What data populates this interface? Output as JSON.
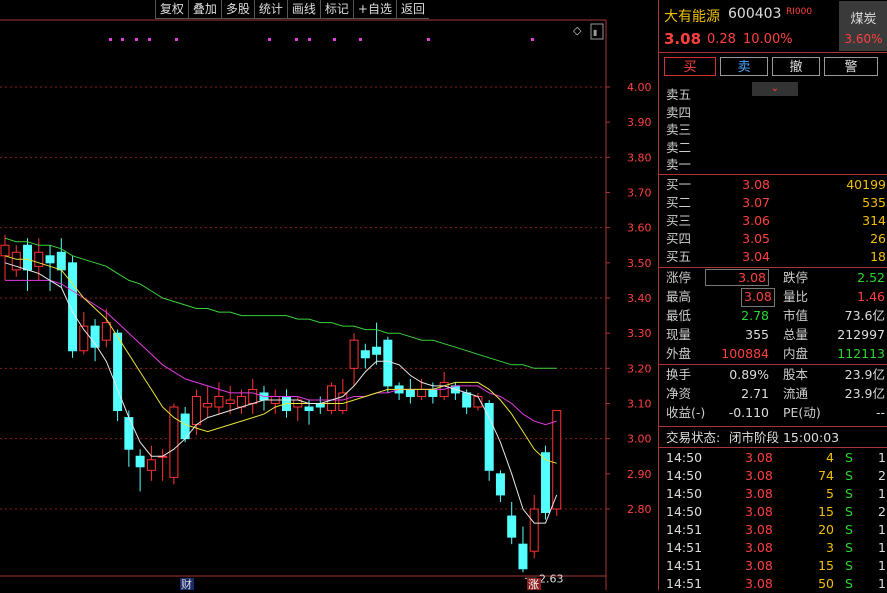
{
  "toolbar": [
    "复权",
    "叠加",
    "多股",
    "统计",
    "画线",
    "标记",
    "+自选",
    "返回"
  ],
  "stock": {
    "name": "大有能源",
    "code": "600403",
    "tag": "RI000",
    "price": "3.08",
    "change": "0.28",
    "pct": "10.00%",
    "sector": "煤炭",
    "sector_pct": "3.60%"
  },
  "trade_buttons": {
    "buy": "买",
    "sell": "卖",
    "cancel": "撤",
    "alert": "警"
  },
  "sell_levels": [
    "卖五",
    "卖四",
    "卖三",
    "卖二",
    "卖一"
  ],
  "buy_levels": [
    {
      "label": "买一",
      "price": "3.08",
      "vol": "40199"
    },
    {
      "label": "买二",
      "price": "3.07",
      "vol": "535"
    },
    {
      "label": "买三",
      "price": "3.06",
      "vol": "314"
    },
    {
      "label": "买四",
      "price": "3.05",
      "vol": "26"
    },
    {
      "label": "买五",
      "price": "3.04",
      "vol": "18"
    }
  ],
  "stats": {
    "limit_up_label": "涨停",
    "limit_up": "3.08",
    "limit_down_label": "跌停",
    "limit_down": "2.52",
    "high_label": "最高",
    "high": "3.08",
    "vol_ratio_label": "量比",
    "vol_ratio": "1.46",
    "low_label": "最低",
    "low": "2.78",
    "mktcap_label": "市值",
    "mktcap": "73.6亿",
    "cur_vol_label": "现量",
    "cur_vol": "355",
    "total_vol_label": "总量",
    "total_vol": "212997",
    "outer_label": "外盘",
    "outer": "100884",
    "inner_label": "内盘",
    "inner": "112113",
    "turnover_label": "换手",
    "turnover": "0.89%",
    "shares_label": "股本",
    "shares": "23.9亿",
    "netasset_label": "净资",
    "netasset": "2.71",
    "float_label": "流通",
    "float": "23.9亿",
    "eps_label": "收益(-)",
    "eps": "-0.110",
    "pe_label": "PE(动)",
    "pe": "--"
  },
  "trade_status": {
    "label": "交易状态:",
    "value": "闭市阶段 15:00:03"
  },
  "ticks": [
    {
      "time": "14:50",
      "price": "3.08",
      "vol": "4",
      "side": "S",
      "n": "1"
    },
    {
      "time": "14:50",
      "price": "3.08",
      "vol": "74",
      "side": "S",
      "n": "2"
    },
    {
      "time": "14:50",
      "price": "3.08",
      "vol": "5",
      "side": "S",
      "n": "1"
    },
    {
      "time": "14:50",
      "price": "3.08",
      "vol": "15",
      "side": "S",
      "n": "2"
    },
    {
      "time": "14:51",
      "price": "3.08",
      "vol": "20",
      "side": "S",
      "n": "1"
    },
    {
      "time": "14:51",
      "price": "3.08",
      "vol": "3",
      "side": "S",
      "n": "1"
    },
    {
      "time": "14:51",
      "price": "3.08",
      "vol": "15",
      "side": "S",
      "n": "1"
    },
    {
      "time": "14:51",
      "price": "3.08",
      "vol": "50",
      "side": "S",
      "n": "1"
    }
  ],
  "chart_data": {
    "type": "candlestick",
    "y_ticks": [
      "4.00",
      "3.90",
      "3.80",
      "3.70",
      "3.60",
      "3.50",
      "3.40",
      "3.30",
      "3.20",
      "3.10",
      "3.00",
      "2.90",
      "2.80"
    ],
    "ylim": [
      2.58,
      4.12
    ],
    "up_color": "#ff3232",
    "down_color": "#54ffff",
    "low_annotation": "2.63",
    "bottom_markers": [
      "财",
      "涨"
    ],
    "candles": [
      [
        3.52,
        3.55,
        3.45,
        3.58
      ],
      [
        3.48,
        3.53,
        3.46,
        3.55
      ],
      [
        3.55,
        3.48,
        3.42,
        3.57
      ],
      [
        3.49,
        3.53,
        3.45,
        3.57
      ],
      [
        3.52,
        3.5,
        3.42,
        3.55
      ],
      [
        3.53,
        3.48,
        3.43,
        3.57
      ],
      [
        3.5,
        3.25,
        3.23,
        3.52
      ],
      [
        3.25,
        3.32,
        3.24,
        3.36
      ],
      [
        3.32,
        3.26,
        3.22,
        3.34
      ],
      [
        3.28,
        3.33,
        3.26,
        3.37
      ],
      [
        3.3,
        3.08,
        3.05,
        3.31
      ],
      [
        3.06,
        2.97,
        2.92,
        3.08
      ],
      [
        2.95,
        2.92,
        2.85,
        2.97
      ],
      [
        2.91,
        2.94,
        2.88,
        2.98
      ],
      [
        2.95,
        2.95,
        2.88,
        2.97
      ],
      [
        2.89,
        3.09,
        2.87,
        3.1
      ],
      [
        3.07,
        3.0,
        2.99,
        3.09
      ],
      [
        3.04,
        3.12,
        3.01,
        3.14
      ],
      [
        3.09,
        3.1,
        3.06,
        3.15
      ],
      [
        3.09,
        3.12,
        3.07,
        3.16
      ],
      [
        3.1,
        3.11,
        3.07,
        3.15
      ],
      [
        3.09,
        3.12,
        3.07,
        3.14
      ],
      [
        3.1,
        3.14,
        3.07,
        3.17
      ],
      [
        3.13,
        3.11,
        3.08,
        3.15
      ],
      [
        3.1,
        3.12,
        3.07,
        3.14
      ],
      [
        3.12,
        3.08,
        3.06,
        3.14
      ],
      [
        3.09,
        3.11,
        3.05,
        3.12
      ],
      [
        3.09,
        3.08,
        3.04,
        3.11
      ],
      [
        3.1,
        3.09,
        3.07,
        3.12
      ],
      [
        3.08,
        3.15,
        3.07,
        3.16
      ],
      [
        3.08,
        3.13,
        3.07,
        3.17
      ],
      [
        3.2,
        3.28,
        3.15,
        3.3
      ],
      [
        3.25,
        3.23,
        3.2,
        3.27
      ],
      [
        3.26,
        3.24,
        3.21,
        3.33
      ],
      [
        3.28,
        3.15,
        3.13,
        3.29
      ],
      [
        3.15,
        3.13,
        3.11,
        3.16
      ],
      [
        3.14,
        3.12,
        3.1,
        3.17
      ],
      [
        3.12,
        3.14,
        3.11,
        3.17
      ],
      [
        3.14,
        3.12,
        3.1,
        3.16
      ],
      [
        3.12,
        3.16,
        3.11,
        3.19
      ],
      [
        3.15,
        3.13,
        3.11,
        3.16
      ],
      [
        3.13,
        3.09,
        3.07,
        3.14
      ],
      [
        3.09,
        3.12,
        3.08,
        3.13
      ],
      [
        3.1,
        2.91,
        2.88,
        3.11
      ],
      [
        2.9,
        2.84,
        2.82,
        2.91
      ],
      [
        2.78,
        2.72,
        2.7,
        2.82
      ],
      [
        2.7,
        2.63,
        2.62,
        2.75
      ],
      [
        2.68,
        2.8,
        2.66,
        2.84
      ],
      [
        2.96,
        2.79,
        2.77,
        2.98
      ],
      [
        2.8,
        3.08,
        2.78,
        3.08
      ]
    ],
    "ma_white": [
      3.5,
      3.49,
      3.48,
      3.47,
      3.45,
      3.43,
      3.36,
      3.31,
      3.27,
      3.22,
      3.14,
      3.06,
      2.99,
      2.95,
      2.95,
      2.97,
      3.0,
      3.04,
      3.06,
      3.07,
      3.08,
      3.09,
      3.1,
      3.11,
      3.11,
      3.11,
      3.11,
      3.1,
      3.1,
      3.11,
      3.12,
      3.15,
      3.19,
      3.22,
      3.22,
      3.21,
      3.18,
      3.16,
      3.15,
      3.15,
      3.14,
      3.13,
      3.12,
      3.06,
      2.99,
      2.9,
      2.8,
      2.76,
      2.76,
      2.84
    ],
    "ma_yellow": [
      3.52,
      3.51,
      3.51,
      3.5,
      3.49,
      3.48,
      3.44,
      3.4,
      3.37,
      3.34,
      3.29,
      3.24,
      3.19,
      3.14,
      3.09,
      3.06,
      3.04,
      3.03,
      3.02,
      3.03,
      3.04,
      3.05,
      3.06,
      3.07,
      3.09,
      3.1,
      3.1,
      3.1,
      3.1,
      3.1,
      3.1,
      3.11,
      3.12,
      3.13,
      3.14,
      3.14,
      3.14,
      3.14,
      3.14,
      3.15,
      3.16,
      3.16,
      3.16,
      3.14,
      3.11,
      3.07,
      3.02,
      2.97,
      2.94,
      2.93
    ],
    "ma_magenta": [
      3.45,
      3.45,
      3.45,
      3.45,
      3.45,
      3.44,
      3.42,
      3.4,
      3.38,
      3.36,
      3.33,
      3.3,
      3.27,
      3.24,
      3.21,
      3.19,
      3.17,
      3.16,
      3.15,
      3.14,
      3.13,
      3.13,
      3.13,
      3.12,
      3.12,
      3.12,
      3.12,
      3.11,
      3.11,
      3.11,
      3.11,
      3.12,
      3.12,
      3.13,
      3.13,
      3.14,
      3.14,
      3.14,
      3.14,
      3.14,
      3.15,
      3.15,
      3.15,
      3.13,
      3.12,
      3.1,
      3.07,
      3.05,
      3.04,
      3.05
    ],
    "ma_green": [
      3.57,
      3.56,
      3.56,
      3.55,
      3.55,
      3.54,
      3.52,
      3.51,
      3.5,
      3.49,
      3.47,
      3.45,
      3.44,
      3.42,
      3.4,
      3.39,
      3.38,
      3.37,
      3.37,
      3.36,
      3.36,
      3.35,
      3.35,
      3.35,
      3.35,
      3.35,
      3.34,
      3.34,
      3.33,
      3.33,
      3.32,
      3.32,
      3.31,
      3.31,
      3.3,
      3.3,
      3.29,
      3.28,
      3.28,
      3.27,
      3.26,
      3.25,
      3.24,
      3.23,
      3.22,
      3.21,
      3.21,
      3.2,
      3.2,
      3.2
    ]
  }
}
